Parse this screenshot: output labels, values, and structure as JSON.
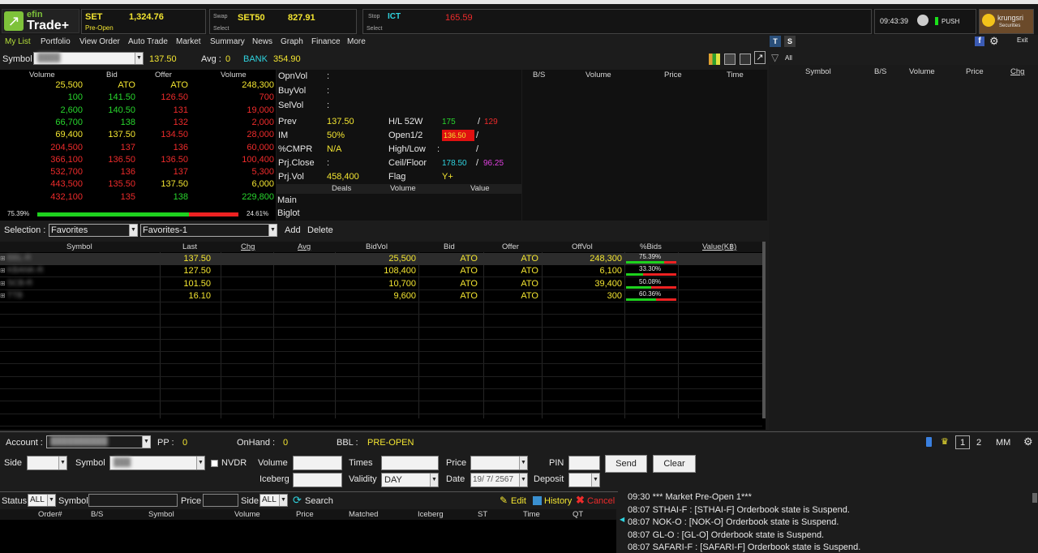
{
  "header": {
    "brand_top": "efin",
    "brand_bottom": "Trade+",
    "set_label": "SET",
    "set_value": "1,324.76",
    "set_status": "Pre-Open",
    "swap_label": "Swap",
    "swap_symbol": "SET50",
    "swap_value": "827.91",
    "swap_select": "Select",
    "stop_label": "Stop",
    "stop_symbol": "ICT",
    "stop_value": "165.59",
    "stop_select": "Select",
    "select_label": "Select",
    "clock": "09:43:39",
    "push": "PUSH",
    "bank_brand": "krungsri",
    "bank_sub": "Securities",
    "exit": "Exit"
  },
  "nav": [
    "My List",
    "Portfolio",
    "View Order",
    "Auto Trade",
    "Market",
    "Summary",
    "News",
    "Graph",
    "Finance",
    "More"
  ],
  "tabs": {
    "t": "T",
    "s": "S"
  },
  "symbol_bar": {
    "label": "Symbol",
    "last": "137.50",
    "avg_label": "Avg :",
    "avg_value": "0",
    "bank_label": "BANK",
    "bank_value": "354.90",
    "filter_all": "All"
  },
  "book": {
    "headers": [
      "Volume",
      "Bid",
      "Offer",
      "Volume"
    ],
    "rows": [
      {
        "bv": "25,500",
        "bid": "ATO",
        "off": "ATO",
        "ov": "248,300"
      },
      {
        "bv": "100",
        "bid": "141.50",
        "off": "126.50",
        "ov": "700"
      },
      {
        "bv": "2,600",
        "bid": "140.50",
        "off": "131",
        "ov": "19,000"
      },
      {
        "bv": "66,700",
        "bid": "138",
        "off": "132",
        "ov": "2,000"
      },
      {
        "bv": "69,400",
        "bid": "137.50",
        "off": "134.50",
        "ov": "28,000"
      },
      {
        "bv": "204,500",
        "bid": "137",
        "off": "136",
        "ov": "60,000"
      },
      {
        "bv": "366,100",
        "bid": "136.50",
        "off": "136.50",
        "ov": "100,400"
      },
      {
        "bv": "532,700",
        "bid": "136",
        "off": "137",
        "ov": "5,300"
      },
      {
        "bv": "443,500",
        "bid": "135.50",
        "off": "137.50",
        "ov": "6,000"
      },
      {
        "bv": "432,100",
        "bid": "135",
        "off": "138",
        "ov": "229,800"
      }
    ],
    "bid_pct": "75.39%",
    "offer_pct": "24.61%",
    "bid_fraction": 0.7539
  },
  "info": {
    "opnvol": "OpnVol",
    "buyvol": "BuyVol",
    "selvol": "SelVol",
    "colon": ":",
    "prev_l": "Prev",
    "prev_v": "137.50",
    "im_l": "IM",
    "im_v": "50%",
    "cmpr_l": "%CMPR",
    "cmpr_v": "N/A",
    "pclose_l": "Prj.Close",
    "pvol_l": "Prj.Vol",
    "pvol_v": "458,400",
    "hl_l": "H/L 52W",
    "hl_h": "175",
    "hl_lo": "129",
    "slash": "/",
    "open_l": "Open1/2",
    "open_v": "136.50",
    "hilo_l": "High/Low",
    "cf_l": "Ceil/Floor",
    "cf_c": "178.50",
    "cf_f": "96.25",
    "flag_l": "Flag",
    "flag_v": "Y+",
    "deals": "Deals",
    "volume": "Volume",
    "value": "Value",
    "main": "Main",
    "biglot": "Biglot"
  },
  "ticks": {
    "headers": [
      "B/S",
      "Volume",
      "Price",
      "Time"
    ]
  },
  "right_headers": [
    "Symbol",
    "B/S",
    "Volume",
    "Price",
    "Chg"
  ],
  "selection": {
    "label": "Selection :",
    "list": "Favorites",
    "sublist": "Favorites-1",
    "add": "Add",
    "delete": "Delete"
  },
  "grid": {
    "headers": [
      "Symbol",
      "Last",
      "Chg",
      "Avg",
      "BidVol",
      "Bid",
      "Offer",
      "OffVol",
      "%Bids",
      "Value(K฿)"
    ],
    "rows": [
      {
        "sym": "BBL-R",
        "last": "137.50",
        "bidvol": "25,500",
        "bid": "ATO",
        "offer": "ATO",
        "offvol": "248,300",
        "pct": "75.39%",
        "frac": 0.7539
      },
      {
        "sym": "KBANK-R",
        "last": "127.50",
        "bidvol": "108,400",
        "bid": "ATO",
        "offer": "ATO",
        "offvol": "6,100",
        "pct": "33.30%",
        "frac": 0.333
      },
      {
        "sym": "SCB-R",
        "last": "101.50",
        "bidvol": "10,700",
        "bid": "ATO",
        "offer": "ATO",
        "offvol": "39,400",
        "pct": "50.08%",
        "frac": 0.5008
      },
      {
        "sym": "TTB",
        "last": "16.10",
        "bidvol": "9,600",
        "bid": "ATO",
        "offer": "ATO",
        "offvol": "300",
        "pct": "60.36%",
        "frac": 0.6036
      }
    ]
  },
  "order": {
    "account": "Account :",
    "pp": "PP :",
    "pp_v": "0",
    "onhand": "OnHand :",
    "onhand_v": "0",
    "bbl": "BBL :",
    "bbl_v": "PRE-OPEN",
    "side": "Side",
    "symbol": "Symbol",
    "nvdr": "NVDR",
    "volume": "Volume",
    "times": "Times",
    "price": "Price",
    "pin": "PIN",
    "send": "Send",
    "clear": "Clear",
    "iceberg": "Iceberg",
    "validity": "Validity",
    "validity_v": "DAY",
    "date": "Date",
    "date_v": "19/ 7/ 2567",
    "deposit": "Deposit",
    "page1": "1",
    "page2": "2",
    "mm": "MM"
  },
  "orders_bar": {
    "status": "Status",
    "status_v": "ALL",
    "symbol": "Symbol",
    "price": "Price",
    "side": "Side",
    "side_v": "ALL",
    "search": "Search",
    "edit": "Edit",
    "history": "History",
    "cancel": "Cancel",
    "headers": [
      "Order#",
      "B/S",
      "Symbol",
      "Volume",
      "Price",
      "Matched",
      "Iceberg",
      "ST",
      "Time",
      "QT"
    ]
  },
  "news": [
    "09:30  *** Market Pre-Open 1***",
    "08:07  STHAI-F : [STHAI-F] Orderbook state is Suspend.",
    "08:07  NOK-O : [NOK-O] Orderbook state is Suspend.",
    "08:07  GL-O : [GL-O] Orderbook state is Suspend.",
    "08:07  SAFARI-F : [SAFARI-F] Orderbook state is Suspend."
  ]
}
